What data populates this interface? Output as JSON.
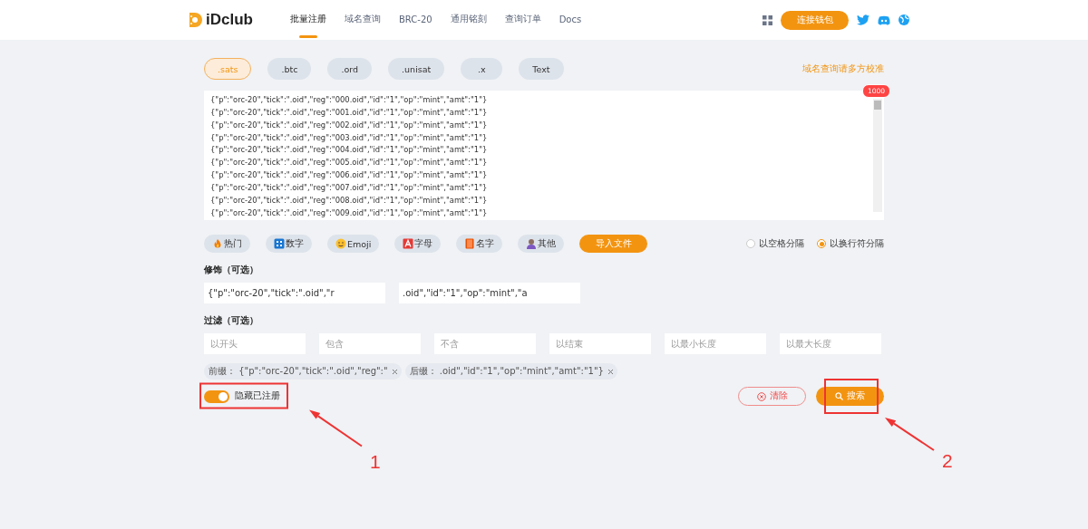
{
  "header": {
    "logo": "iDclub",
    "nav": [
      {
        "label": "批量注册",
        "selected": true
      },
      {
        "label": "域名查询",
        "selected": false
      },
      {
        "label": "BRC-20",
        "selected": false
      },
      {
        "label": "通用铭刻",
        "selected": false
      },
      {
        "label": "查询订单",
        "selected": false
      },
      {
        "label": "Docs",
        "selected": false
      }
    ],
    "connect_button": "连接钱包"
  },
  "suffix_tabs": [
    {
      "label": ".sats",
      "selected": true
    },
    {
      "label": ".btc",
      "selected": false
    },
    {
      "label": ".ord",
      "selected": false
    },
    {
      "label": ".unisat",
      "selected": false
    },
    {
      "label": ".x",
      "selected": false
    },
    {
      "label": "Text",
      "selected": false
    }
  ],
  "query_note": "域名查询请多方校准",
  "editor": {
    "count_badge": "1000",
    "lines": [
      "{\"p\":\"orc-20\",\"tick\":\".oid\",\"reg\":\"000.oid\",\"id\":\"1\",\"op\":\"mint\",\"amt\":\"1\"}",
      "{\"p\":\"orc-20\",\"tick\":\".oid\",\"reg\":\"001.oid\",\"id\":\"1\",\"op\":\"mint\",\"amt\":\"1\"}",
      "{\"p\":\"orc-20\",\"tick\":\".oid\",\"reg\":\"002.oid\",\"id\":\"1\",\"op\":\"mint\",\"amt\":\"1\"}",
      "{\"p\":\"orc-20\",\"tick\":\".oid\",\"reg\":\"003.oid\",\"id\":\"1\",\"op\":\"mint\",\"amt\":\"1\"}",
      "{\"p\":\"orc-20\",\"tick\":\".oid\",\"reg\":\"004.oid\",\"id\":\"1\",\"op\":\"mint\",\"amt\":\"1\"}",
      "{\"p\":\"orc-20\",\"tick\":\".oid\",\"reg\":\"005.oid\",\"id\":\"1\",\"op\":\"mint\",\"amt\":\"1\"}",
      "{\"p\":\"orc-20\",\"tick\":\".oid\",\"reg\":\"006.oid\",\"id\":\"1\",\"op\":\"mint\",\"amt\":\"1\"}",
      "{\"p\":\"orc-20\",\"tick\":\".oid\",\"reg\":\"007.oid\",\"id\":\"1\",\"op\":\"mint\",\"amt\":\"1\"}",
      "{\"p\":\"orc-20\",\"tick\":\".oid\",\"reg\":\"008.oid\",\"id\":\"1\",\"op\":\"mint\",\"amt\":\"1\"}",
      "{\"p\":\"orc-20\",\"tick\":\".oid\",\"reg\":\"009.oid\",\"id\":\"1\",\"op\":\"mint\",\"amt\":\"1\"}"
    ]
  },
  "presets": [
    {
      "label": "热门",
      "kind": "fire"
    },
    {
      "label": "数字",
      "kind": "digits"
    },
    {
      "label": "Emoji",
      "kind": "smiley"
    },
    {
      "label": "字母",
      "kind": "letter"
    },
    {
      "label": "名字",
      "kind": "book"
    },
    {
      "label": "其他",
      "kind": "person"
    }
  ],
  "import_button": "导入文件",
  "separators": [
    {
      "label": "以空格分隔",
      "selected": false
    },
    {
      "label": "以换行符分隔",
      "selected": true
    }
  ],
  "decorate": {
    "title": "修饰（可选）",
    "fields": [
      {
        "value": "{\"p\":\"orc-20\",\"tick\":\".oid\",\"r"
      },
      {
        "value": ".oid\",\"id\":\"1\",\"op\":\"mint\",\"a"
      }
    ]
  },
  "filter": {
    "title": "过滤（可选）",
    "fields": [
      {
        "placeholder": "以开头"
      },
      {
        "placeholder": "包含"
      },
      {
        "placeholder": "不含"
      },
      {
        "placeholder": "以结束"
      },
      {
        "placeholder": "以最小长度"
      },
      {
        "placeholder": "以最大长度"
      }
    ]
  },
  "tags": [
    {
      "label": "前缀：",
      "value": "{\"p\":\"orc-20\",\"tick\":\".oid\",\"reg\":\""
    },
    {
      "label": "后缀：",
      "value": ".oid\",\"id\":\"1\",\"op\":\"mint\",\"amt\":\"1\"}"
    }
  ],
  "hide_registered": {
    "label": "隐藏已注册",
    "on": true
  },
  "clear_button": "清除",
  "search_button": "搜索",
  "annotations": [
    "1",
    "2"
  ]
}
